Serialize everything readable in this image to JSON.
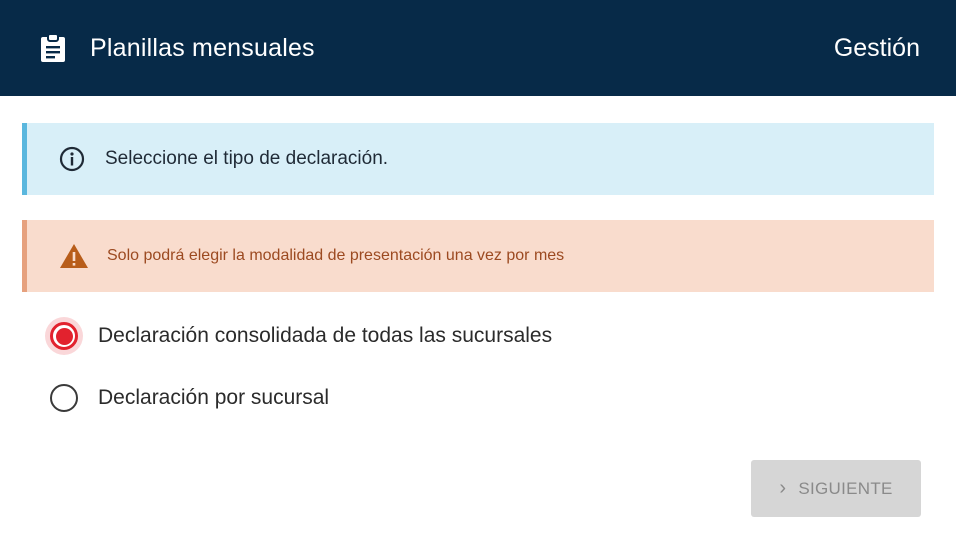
{
  "header": {
    "icon": "clipboard-list-icon",
    "title": "Planillas mensuales",
    "nav_link": "Gestión"
  },
  "info_alert": {
    "icon": "info-circle-icon",
    "text": "Seleccione el tipo de declaración."
  },
  "warning_alert": {
    "icon": "warning-triangle-icon",
    "text": "Solo podrá elegir la modalidad de presentación una vez por mes"
  },
  "declaration_options": [
    {
      "label": "Declaración consolidada de todas las sucursales",
      "selected": true
    },
    {
      "label": "Declaración por sucursal",
      "selected": false
    }
  ],
  "next_button": {
    "icon": "chevron-right-icon",
    "chevron": "›",
    "label": "SIGUIENTE",
    "disabled": true
  },
  "colors": {
    "header_bg": "#072a48",
    "info_bg": "#d8eff8",
    "info_border": "#5ab7de",
    "warning_bg": "#f9dccd",
    "warning_text": "#9c4a21",
    "warning_icon": "#b85d1a",
    "radio_selected": "#e2222e",
    "button_disabled_bg": "#d6d6d6"
  }
}
